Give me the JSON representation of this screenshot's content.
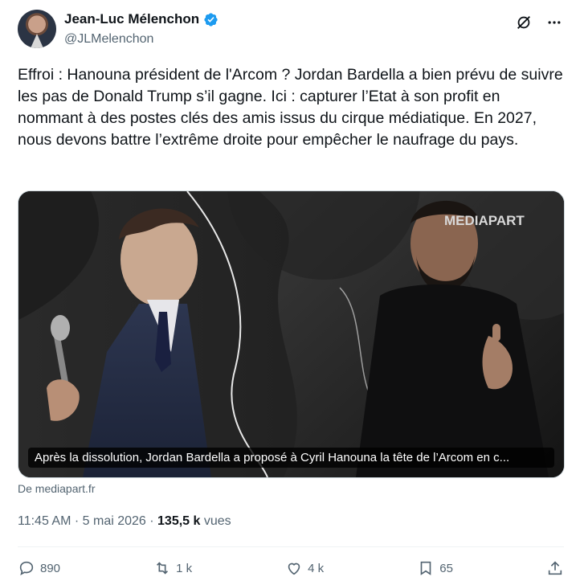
{
  "author": {
    "display_name": "Jean-Luc Mélenchon",
    "handle": "@JLMelenchon",
    "verified_color": "#1d9bf0"
  },
  "tweet": {
    "text": "Effroi : Hanouna président de l'Arcom ? Jordan Bardella a bien prévu de suivre les pas de Donald Trump s’il gagne. Ici : capturer l’Etat à son profit en nommant à des postes clés des amis issus du cirque médiatique. En 2027, nous devons battre l’extrême droite pour empêcher le naufrage du pays."
  },
  "card": {
    "watermark": "MEDIAPART",
    "caption": "Après la dissolution, Jordan Bardella a proposé à Cyril Hanouna la tête de l’Arcom en c...",
    "source": "De mediapart.fr"
  },
  "meta": {
    "time": "11:45 AM",
    "separator": " · ",
    "date": "5 mai 2026",
    "views_count": "135,5 k",
    "views_label": " vues"
  },
  "actions": {
    "replies": "890",
    "reposts": "1 k",
    "likes": "4 k",
    "bookmarks": "65"
  },
  "icons": [
    "verified-icon",
    "grok-icon",
    "more-icon",
    "reply-icon",
    "repost-icon",
    "like-icon",
    "bookmark-icon",
    "share-icon"
  ]
}
